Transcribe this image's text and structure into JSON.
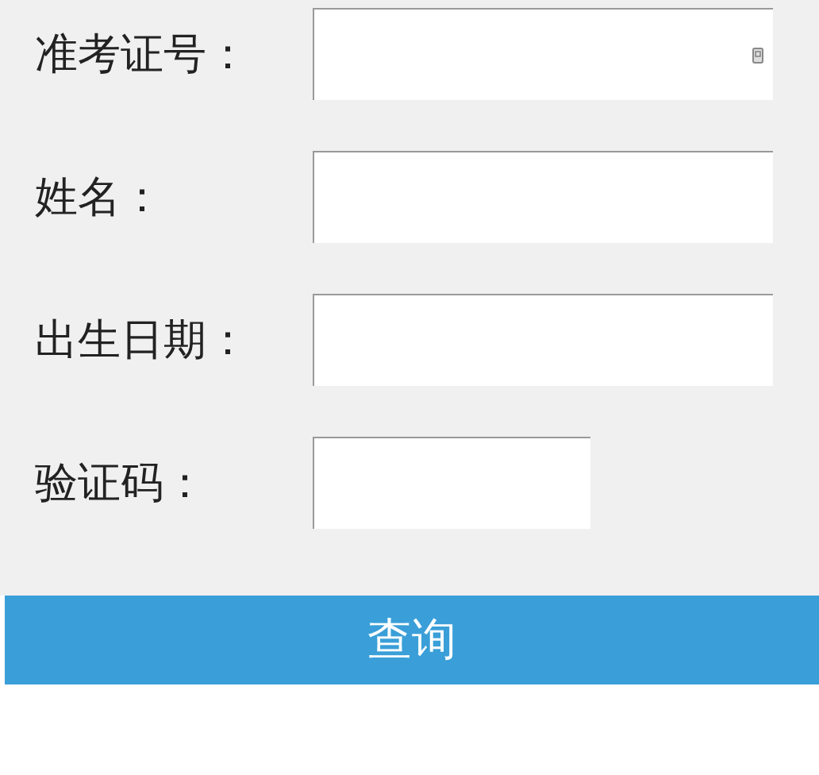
{
  "fields": [
    {
      "label": "准考证号：",
      "kind": "autofill"
    },
    {
      "label": "姓名：",
      "kind": "text"
    },
    {
      "label": "出生日期：",
      "kind": "text"
    },
    {
      "label": "验证码：",
      "kind": "captcha"
    }
  ],
  "submit_button": "查询"
}
